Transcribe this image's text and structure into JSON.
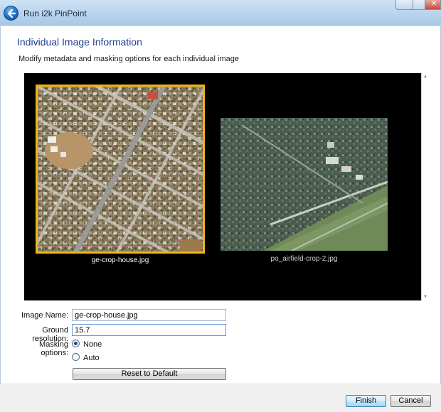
{
  "window": {
    "title": "Run i2k PinPoint"
  },
  "page": {
    "title": "Individual Image Information",
    "description": "Modify metadata and masking options for each individual image"
  },
  "images": [
    {
      "filename": "ge-crop-house.jpg",
      "selected": true
    },
    {
      "filename": "po_airfield-crop-2.jpg",
      "selected": false
    }
  ],
  "form": {
    "image_name_label": "Image Name:",
    "image_name_value": "ge-crop-house.jpg",
    "ground_resolution_label": "Ground resolution:",
    "ground_resolution_value": "15.7",
    "masking_label": "Masking options:",
    "masking_options": [
      {
        "label": "None",
        "checked": true
      },
      {
        "label": "Auto",
        "checked": false
      }
    ],
    "reset_button": "Reset to Default"
  },
  "footer": {
    "finish_button": "Finish",
    "cancel_button": "Cancel"
  },
  "colors": {
    "title_blue": "#1f3f8e",
    "selection_border": "#f2b514",
    "viewport_bg": "#000000"
  }
}
